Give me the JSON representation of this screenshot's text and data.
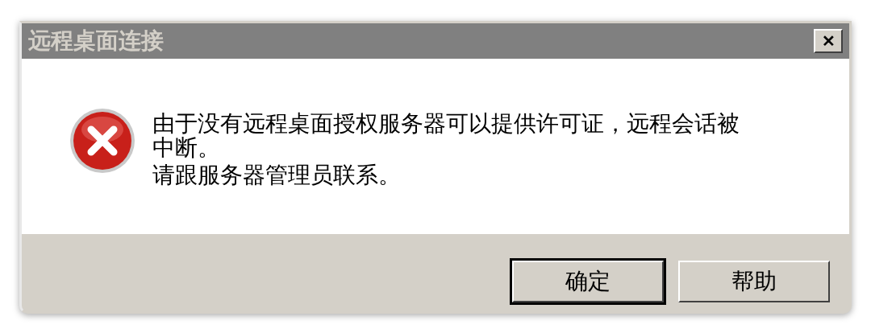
{
  "window": {
    "title": "远程桌面连接",
    "close": "✕"
  },
  "message_lines": [
    "由于没有远程桌面授权服务器可以提供许可证，远程会话被",
    "中断。",
    "请跟服务器管理员联系。"
  ],
  "buttons": [
    {
      "label": "确定",
      "default": true
    },
    {
      "label": "帮助",
      "default": false
    }
  ]
}
